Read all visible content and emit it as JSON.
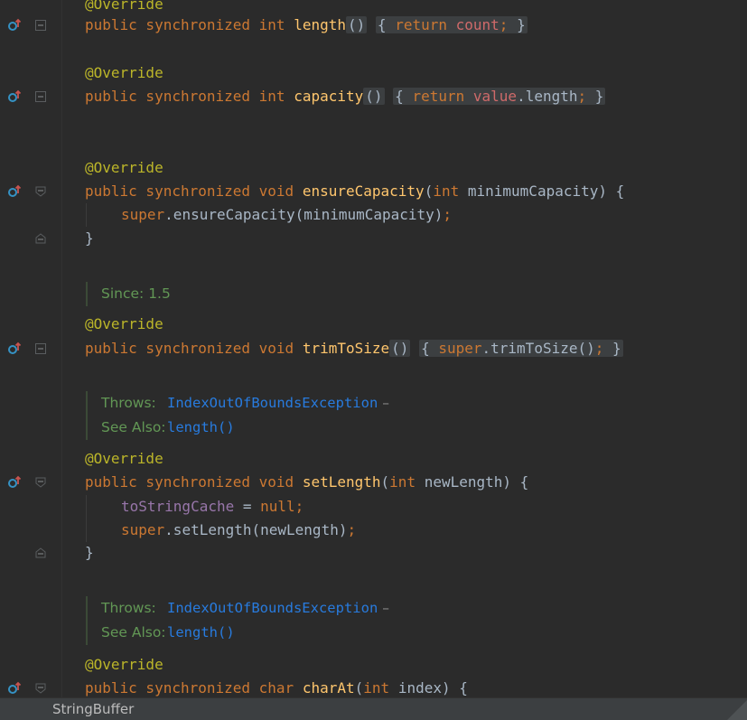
{
  "colors": {
    "keyword": "#cc7832",
    "annotation": "#bbb529",
    "method": "#ffc66d",
    "field": "#9876aa",
    "doc": "#629755",
    "link": "#287bde",
    "background": "#2b2b2b"
  },
  "icons": {
    "implements": "overrides-method-icon",
    "fold": "fold-toggle-icon"
  },
  "lines": {
    "l0_ann": "@Override",
    "l1_kw": "public synchronized int",
    "l1_fn": "length",
    "l1_paren": "()",
    "l1_ret": "return",
    "l1_field": "count",
    "l1_semi": ";",
    "l2_ann": "@Override",
    "l3_kw": "public synchronized int",
    "l3_fn": "capacity",
    "l3_paren": "()",
    "l3_ret": "return",
    "l3_field": "value",
    "l3_rest": ".length",
    "l3_semi": ";",
    "l4_ann": "@Override",
    "l5_kw": "public synchronized void",
    "l5_fn": "ensureCapacity",
    "l5_paren_open": "(",
    "l5_type": "int",
    "l5_rest": "minimumCapacity) {",
    "l6_kw": "super",
    "l6_rest": ".ensureCapacity(minimumCapacity)",
    "l6_semi": ";",
    "l7_close": "}",
    "since_label": "Since:",
    "since_value": "1.5",
    "l8_ann": "@Override",
    "l9_kw": "public synchronized void",
    "l9_fn": "trimToSize",
    "l9_paren": "()",
    "l9_super": "super",
    "l9_rest": ".trimToSize()",
    "l9_semi": ";",
    "doc1_throws_label": "Throws:",
    "doc1_throws_value": "IndexOutOfBoundsException",
    "doc1_dash": "–",
    "doc1_see_label": "See Also:",
    "doc1_see_value": "length()",
    "l10_ann": "@Override",
    "l11_kw": "public synchronized void",
    "l11_fn": "setLength",
    "l11_paren_open": "(",
    "l11_type": "int",
    "l11_rest": "newLength) {",
    "l12_field": "toStringCache",
    "l12_eq": " = ",
    "l12_null": "null",
    "l12_semi": ";",
    "l13_kw": "super",
    "l13_rest": ".setLength(newLength)",
    "l13_semi": ";",
    "l14_close": "}",
    "doc2_throws_label": "Throws:",
    "doc2_throws_value": "IndexOutOfBoundsException",
    "doc2_dash": "–",
    "doc2_see_label": "See Also:",
    "doc2_see_value": "length()",
    "l15_ann": "@Override",
    "l16_kw": "public synchronized char",
    "l16_fn": "charAt",
    "l16_paren_open": "(",
    "l16_type": "int",
    "l16_rest": "index) {"
  },
  "fold_open": "{",
  "fold_close": "}",
  "statusbar": {
    "breadcrumb": "StringBuffer"
  }
}
